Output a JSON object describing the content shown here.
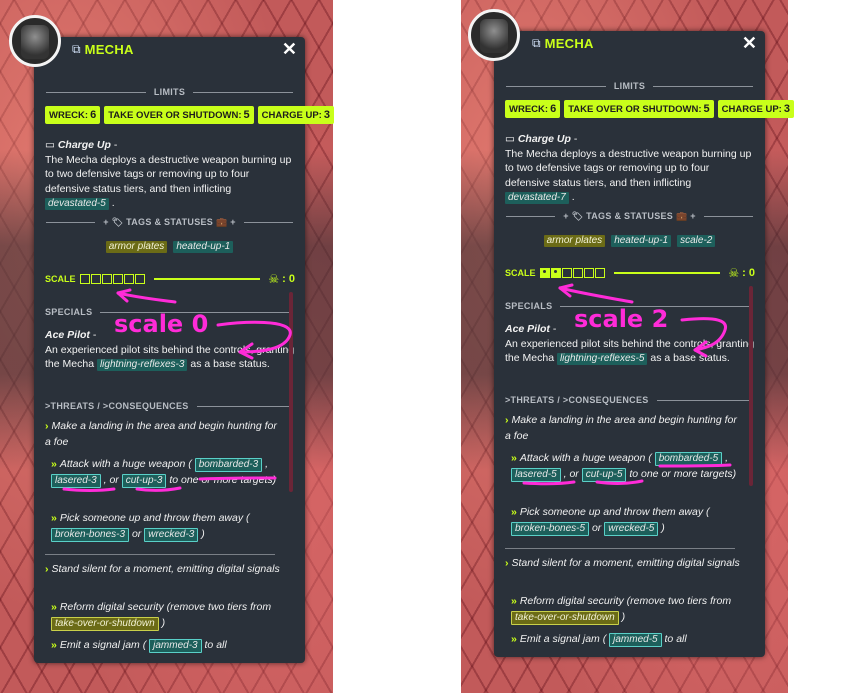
{
  "panels": [
    {
      "title": "MECHA",
      "limits_label": "LIMITS",
      "limits": [
        {
          "label": "WRECK:",
          "value": "6"
        },
        {
          "label": "TAKE OVER OR SHUTDOWN:",
          "value": "5"
        },
        {
          "label": "CHARGE UP:",
          "value": "3"
        }
      ],
      "charge_name": "Charge Up",
      "charge_text_1": "The Mecha deploys a destructive weapon burning up to two defensive tags or removing up to four defensive status tiers, and then inflicting",
      "charge_tag": "devastated-5",
      "tags_label": "TAGS & STATUSES",
      "tags": [
        "armor plates",
        "heated-up-1"
      ],
      "scale_label": "SCALE",
      "scale_filled": 0,
      "scale_total": 6,
      "skull_value": ": 0",
      "specials_label": "SPECIALS",
      "ace_name": "Ace Pilot",
      "ace_text": "An experienced pilot sits behind the controls, granting the Mecha",
      "ace_tag": "lightning-reflexes-3",
      "ace_text_2": "as a base status.",
      "threats_label": ">THREATS / >CONSEQUENCES",
      "t1": "Make a landing in the area and begin hunting for a foe",
      "c1_pre": "Attack with a huge weapon (",
      "c1_tags": [
        "bombarded-3",
        "lasered-3",
        "cut-up-3"
      ],
      "c1_post": "to one or more targets)",
      "c2_pre": "Pick someone up and throw them away (",
      "c2_tags": [
        "broken-bones-3",
        "wrecked-3"
      ],
      "t2": "Stand silent for a moment, emitting digital signals",
      "c3_pre": "Reform digital security (remove two tiers from",
      "c3_tag": "take-over-or-shutdown",
      "c4_pre": "Emit a signal jam (",
      "c4_tag": "jammed-3",
      "c4_post": "to all",
      "annotation": "scale 0"
    },
    {
      "title": "MECHA",
      "limits_label": "LIMITS",
      "limits": [
        {
          "label": "WRECK:",
          "value": "6"
        },
        {
          "label": "TAKE OVER OR SHUTDOWN:",
          "value": "5"
        },
        {
          "label": "CHARGE UP:",
          "value": "3"
        }
      ],
      "charge_name": "Charge Up",
      "charge_text_1": "The Mecha deploys a destructive weapon burning up to two defensive tags or removing up to four defensive status tiers, and then inflicting",
      "charge_tag": "devastated-7",
      "tags_label": "TAGS & STATUSES",
      "tags": [
        "armor plates",
        "heated-up-1",
        "scale-2"
      ],
      "scale_label": "SCALE",
      "scale_filled": 2,
      "scale_total": 6,
      "skull_value": ": 0",
      "specials_label": "SPECIALS",
      "ace_name": "Ace Pilot",
      "ace_text": "An experienced pilot sits behind the controls, granting the Mecha",
      "ace_tag": "lightning-reflexes-5",
      "ace_text_2": "as a base status.",
      "threats_label": ">THREATS / >CONSEQUENCES",
      "t1": "Make a landing in the area and begin hunting for a foe",
      "c1_pre": "Attack with a huge weapon (",
      "c1_tags": [
        "bombarded-5",
        "lasered-5",
        "cut-up-5"
      ],
      "c1_post": "to one or more targets)",
      "c2_pre": "Pick someone up and throw them away (",
      "c2_tags": [
        "broken-bones-5",
        "wrecked-5"
      ],
      "t2": "Stand silent for a moment, emitting digital signals",
      "c3_pre": "Reform digital security (remove two tiers from",
      "c3_tag": "take-over-or-shutdown",
      "c4_pre": "Emit a signal jam (",
      "c4_tag": "jammed-5",
      "c4_post": "to all",
      "annotation": "scale 2"
    }
  ],
  "colors": {
    "accent": "#c9ff1a",
    "card": "#2a313a",
    "annotation": "#ff2bd8",
    "tag_teal": "#1d5f5b",
    "tag_olive": "#6b6b16"
  }
}
